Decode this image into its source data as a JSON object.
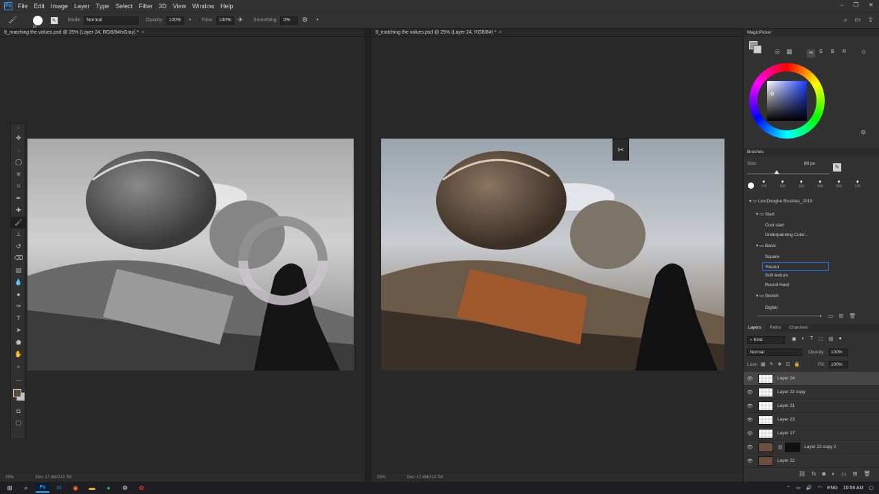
{
  "menubar": {
    "app_logo": "Ps",
    "items": [
      "File",
      "Edit",
      "Image",
      "Layer",
      "Type",
      "Select",
      "Filter",
      "3D",
      "View",
      "Window",
      "Help"
    ]
  },
  "options_bar": {
    "brush_size": "80",
    "mode_label": "Mode:",
    "mode_value": "Normal",
    "opacity_label": "Opacity:",
    "opacity_value": "100%",
    "flow_label": "Flow:",
    "flow_value": "100%",
    "smoothing_label": "Smoothing:",
    "smoothing_value": "0%"
  },
  "documents": [
    {
      "tab_title": "8_matching the values.psd @ 25% (Layer 24, RGB/8#/sGray) *",
      "zoom": "25%",
      "doc_size": "Doc: 17.4M/212.7M"
    },
    {
      "tab_title": "8_matching the values.psd @ 25% (Layer 24, RGB/8#) *",
      "zoom": "25%",
      "doc_size": "Doc: 17.4M/212.7M"
    }
  ],
  "magic_picker": {
    "title": "MagicPicker",
    "modes": [
      "H",
      "S",
      "B",
      "R"
    ]
  },
  "brushes": {
    "title": "Brushes",
    "size_label": "Size:",
    "size_value": "80 px",
    "presets": [
      "175",
      "150",
      "100",
      "300",
      "200",
      "125"
    ],
    "folder_root": "LinoDrieghe Brushes_2019",
    "groups": [
      {
        "name": "Start",
        "items": [
          "Cool start",
          "Underpainting Color..."
        ]
      },
      {
        "name": "Basic",
        "items": [
          "Square",
          "Round",
          "Soft texture",
          "Round Hard"
        ]
      },
      {
        "name": "Sketch",
        "items": [
          "Digital"
        ]
      }
    ],
    "selected": "Round"
  },
  "layers_panel": {
    "tabs": [
      "Layers",
      "Paths",
      "Channels"
    ],
    "filter_kind": "Kind",
    "blend_mode": "Normal",
    "opacity_label": "Opacity:",
    "opacity_value": "100%",
    "lock_label": "Lock:",
    "fill_label": "Fill:",
    "fill_value": "100%",
    "layers": [
      "Layer 24",
      "Layer 22 copy",
      "Layer 21",
      "Layer 23",
      "Layer 17",
      "Layer 22 copy 2",
      "Layer 22"
    ],
    "selected_layer": "Layer 24"
  },
  "taskbar": {
    "language": "ENG",
    "time": "10:56 AM"
  },
  "colors": {
    "ps_blue": "#31a8ff",
    "panel_bg": "#323232",
    "selection_blue": "#1473e6"
  }
}
